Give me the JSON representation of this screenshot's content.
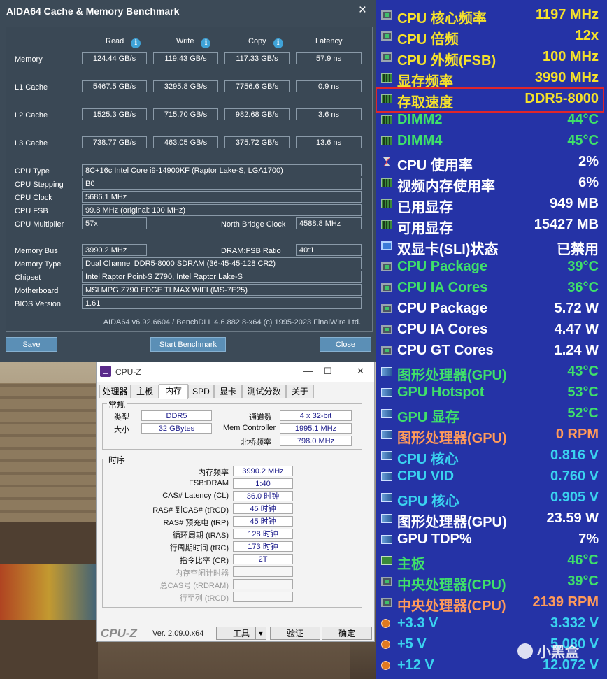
{
  "aida": {
    "title": "AIDA64 Cache & Memory Benchmark",
    "close_glyph": "×",
    "info_glyph": "i",
    "headers": {
      "read": "Read",
      "write": "Write",
      "copy": "Copy",
      "latency": "Latency"
    },
    "rows": [
      {
        "label": "Memory",
        "read": "124.44 GB/s",
        "write": "119.43 GB/s",
        "copy": "117.33 GB/s",
        "latency": "57.9 ns"
      },
      {
        "label": "L1 Cache",
        "read": "5467.5 GB/s",
        "write": "3295.8 GB/s",
        "copy": "7756.6 GB/s",
        "latency": "0.9 ns"
      },
      {
        "label": "L2 Cache",
        "read": "1525.3 GB/s",
        "write": "715.70 GB/s",
        "copy": "982.68 GB/s",
        "latency": "3.6 ns"
      },
      {
        "label": "L3 Cache",
        "read": "738.77 GB/s",
        "write": "463.05 GB/s",
        "copy": "375.72 GB/s",
        "latency": "13.6 ns"
      }
    ],
    "info": {
      "cpu_type_label": "CPU Type",
      "cpu_type": "8C+16c Intel Core i9-14900KF  (Raptor Lake-S, LGA1700)",
      "cpu_stepping_label": "CPU Stepping",
      "cpu_stepping": "B0",
      "cpu_clock_label": "CPU Clock",
      "cpu_clock": "5686.1 MHz",
      "cpu_fsb_label": "CPU FSB",
      "cpu_fsb": "99.8 MHz  (original: 100 MHz)",
      "cpu_multiplier_label": "CPU Multiplier",
      "cpu_multiplier": "57x",
      "nb_clock_label": "North Bridge Clock",
      "nb_clock": "4588.8 MHz",
      "memory_bus_label": "Memory Bus",
      "memory_bus": "3990.2 MHz",
      "dram_fsb_label": "DRAM:FSB Ratio",
      "dram_fsb": "40:1",
      "memory_type_label": "Memory Type",
      "memory_type": "Dual Channel DDR5-8000 SDRAM  (36-45-45-128 CR2)",
      "chipset_label": "Chipset",
      "chipset": "Intel Raptor Point-S Z790, Intel Raptor Lake-S",
      "motherboard_label": "Motherboard",
      "motherboard": "MSI MPG Z790 EDGE TI MAX WIFI (MS-7E25)",
      "bios_label": "BIOS Version",
      "bios": "1.61"
    },
    "footer": "AIDA64 v6.92.6604 / BenchDLL 4.6.882.8-x64  (c) 1995-2023 FinalWire Ltd.",
    "buttons": {
      "save_u": "S",
      "save_rest": "ave",
      "start": "Start Benchmark",
      "close_u": "C",
      "close_rest": "lose"
    }
  },
  "cpuz": {
    "title": "CPU-Z",
    "min_glyph": "—",
    "max_glyph": "☐",
    "close_glyph": "✕",
    "tabs": [
      "处理器",
      "主板",
      "内存",
      "SPD",
      "显卡",
      "测试分数",
      "关于"
    ],
    "general": {
      "group": "常规",
      "type_label": "类型",
      "type": "DDR5",
      "size_label": "大小",
      "size": "32 GBytes",
      "channels_label": "通道数",
      "channels": "4 x 32-bit",
      "memctrl_label": "Mem Controller",
      "memctrl": "1995.1 MHz",
      "nb_label": "北桥频率",
      "nb": "798.0 MHz"
    },
    "timings": {
      "group": "时序",
      "rows": [
        {
          "label": "内存频率",
          "value": "3990.2 MHz",
          "disabled": false
        },
        {
          "label": "FSB:DRAM",
          "value": "1:40",
          "disabled": false
        },
        {
          "label": "CAS# Latency (CL)",
          "value": "36.0 时钟",
          "disabled": false
        },
        {
          "label": "RAS# 到CAS# (tRCD)",
          "value": "45 时钟",
          "disabled": false
        },
        {
          "label": "RAS# 预充电 (tRP)",
          "value": "45 时钟",
          "disabled": false
        },
        {
          "label": "循环周期 (tRAS)",
          "value": "128 时钟",
          "disabled": false
        },
        {
          "label": "行周期时间 (tRC)",
          "value": "173 时钟",
          "disabled": false
        },
        {
          "label": "指令比率 (CR)",
          "value": "2T",
          "disabled": false
        },
        {
          "label": "内存空闲计时器",
          "value": "",
          "disabled": true
        },
        {
          "label": "总CAS号 (tRDRAM)",
          "value": "",
          "disabled": true
        },
        {
          "label": "行至列 (tRCD)",
          "value": "",
          "disabled": true
        }
      ]
    },
    "bottom": {
      "brand": "CPU-Z",
      "version": "Ver. 2.09.0.x64",
      "tools": "工具",
      "tools_arrow": "▼",
      "validate": "验证",
      "ok": "确定"
    }
  },
  "sensors": {
    "colors": {
      "background": "#2533a6",
      "yellow": "#f5e12b",
      "green": "#3fe06a",
      "white": "#ffffff",
      "cyan": "#3ad3f0",
      "orange": "#ff9a5a",
      "highlight": "#e0262b"
    },
    "rows": [
      {
        "name": "CPU 核心频率",
        "value": "1197 MHz",
        "icon": "chip-icon",
        "color": "#f5e12b"
      },
      {
        "name": "CPU 倍频",
        "value": "12x",
        "icon": "chip-icon",
        "color": "#f5e12b"
      },
      {
        "name": "CPU 外频(FSB)",
        "value": "100 MHz",
        "icon": "chip-icon",
        "color": "#f5e12b"
      },
      {
        "name": "显存频率",
        "value": "3990 MHz",
        "icon": "memory-icon",
        "color": "#f5e12b"
      },
      {
        "name": "存取速度",
        "value": "DDR5-8000",
        "icon": "memory-icon",
        "color": "#f5e12b"
      },
      {
        "name": "DIMM2",
        "value": "44°C",
        "icon": "memory-icon",
        "color": "#3fe06a"
      },
      {
        "name": "DIMM4",
        "value": "45°C",
        "icon": "memory-icon",
        "color": "#3fe06a"
      },
      {
        "name": "CPU 使用率",
        "value": "2%",
        "icon": "hourglass-icon",
        "color": "#ffffff"
      },
      {
        "name": "视频内存使用率",
        "value": "6%",
        "icon": "memory-icon",
        "color": "#ffffff"
      },
      {
        "name": "已用显存",
        "value": "949 MB",
        "icon": "memory-icon",
        "color": "#ffffff"
      },
      {
        "name": "可用显存",
        "value": "15427 MB",
        "icon": "memory-icon",
        "color": "#ffffff"
      },
      {
        "name": "双显卡(SLI)状态",
        "value": "已禁用",
        "icon": "monitor-icon",
        "color": "#ffffff"
      },
      {
        "name": "CPU Package",
        "value": "39°C",
        "icon": "chip-icon",
        "color": "#3fe06a"
      },
      {
        "name": "CPU IA Cores",
        "value": "36°C",
        "icon": "chip-icon",
        "color": "#3fe06a"
      },
      {
        "name": "CPU Package",
        "value": "5.72 W",
        "icon": "chip-icon",
        "color": "#ffffff"
      },
      {
        "name": "CPU IA Cores",
        "value": "4.47 W",
        "icon": "chip-icon",
        "color": "#ffffff"
      },
      {
        "name": "CPU GT Cores",
        "value": "1.24 W",
        "icon": "chip-icon",
        "color": "#ffffff"
      },
      {
        "name": "图形处理器(GPU)",
        "value": "43°C",
        "icon": "gpu-icon",
        "color": "#3fe06a"
      },
      {
        "name": "GPU Hotspot",
        "value": "53°C",
        "icon": "gpu-icon",
        "color": "#3fe06a"
      },
      {
        "name": "GPU 显存",
        "value": "52°C",
        "icon": "gpu-icon",
        "color": "#3fe06a"
      },
      {
        "name": "图形处理器(GPU)",
        "value": "0 RPM",
        "icon": "gpu-icon",
        "color": "#ff9a5a"
      },
      {
        "name": "CPU 核心",
        "value": "0.816 V",
        "icon": "gpu-icon",
        "color": "#3ad3f0"
      },
      {
        "name": "CPU VID",
        "value": "0.760 V",
        "icon": "gpu-icon",
        "color": "#3ad3f0"
      },
      {
        "name": "GPU 核心",
        "value": "0.905 V",
        "icon": "gpu-icon",
        "color": "#3ad3f0"
      },
      {
        "name": "图形处理器(GPU)",
        "value": "23.59 W",
        "icon": "gpu-icon",
        "color": "#ffffff"
      },
      {
        "name": "GPU TDP%",
        "value": "7%",
        "icon": "gpu-icon",
        "color": "#ffffff"
      },
      {
        "name": "主板",
        "value": "46°C",
        "icon": "motherboard-icon",
        "color": "#3fe06a"
      },
      {
        "name": "中央处理器(CPU)",
        "value": "39°C",
        "icon": "chip-icon",
        "color": "#3fe06a"
      },
      {
        "name": "中央处理器(CPU)",
        "value": "2139 RPM",
        "icon": "chip-icon",
        "color": "#ff9a5a"
      },
      {
        "name": "+3.3 V",
        "value": "3.332 V",
        "icon": "voltage-icon",
        "color": "#3ad3f0"
      },
      {
        "name": "+5 V",
        "value": "5.080 V",
        "icon": "voltage-icon",
        "color": "#3ad3f0"
      },
      {
        "name": "+12 V",
        "value": "12.072 V",
        "icon": "voltage-icon",
        "color": "#3ad3f0"
      }
    ],
    "watermark": "小黑盒"
  }
}
